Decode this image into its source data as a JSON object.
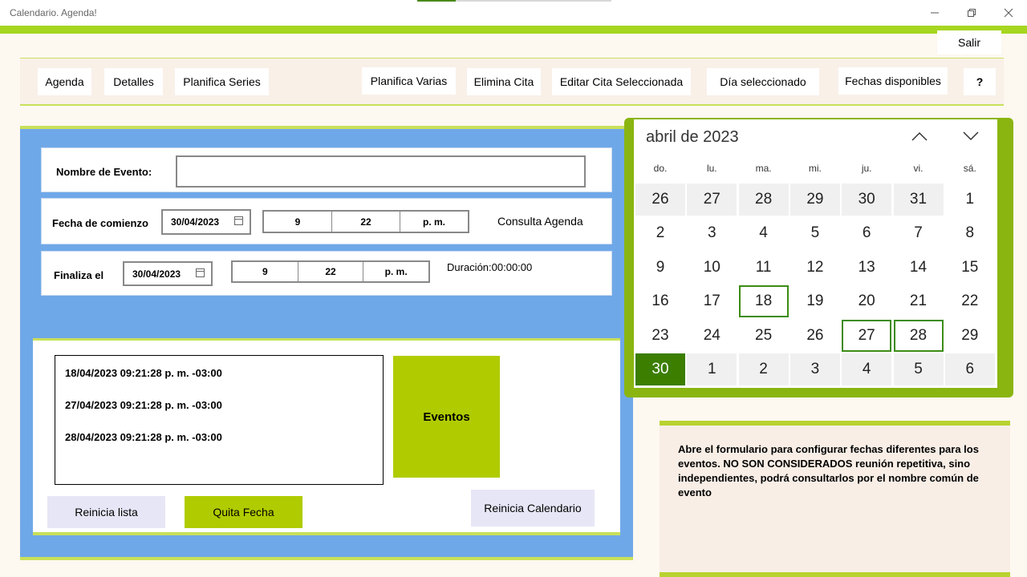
{
  "window": {
    "title": "Calendario. Agenda!",
    "minimize_icon": "minimize-icon",
    "restore_icon": "restore-icon",
    "close_icon": "close-icon"
  },
  "header": {
    "salir_label": "Salir"
  },
  "toolbar": {
    "agenda": "Agenda",
    "detalles": "Detalles",
    "planifica_series": "Planifica Series",
    "planifica_varias": "Planifica Varias",
    "elimina_cita": "Elimina Cita",
    "editar_cita": "Editar Cita Seleccionada",
    "dia_seleccionado": "Día seleccionado",
    "fechas_disponibles": "Fechas disponibles",
    "help": "?"
  },
  "form": {
    "nombre_label": "Nombre de Evento:",
    "nombre_value": "",
    "comienzo_label": "Fecha de comienzo",
    "comienzo_date": "30/04/2023",
    "comienzo_hour": "9",
    "comienzo_minute": "22",
    "comienzo_period": "p. m.",
    "consulta_agenda": "Consulta Agenda",
    "finaliza_label": "Finaliza el",
    "finaliza_date": "30/04/2023",
    "finaliza_hour": "9",
    "finaliza_minute": "22",
    "finaliza_period": "p. m.",
    "duracion": "Duración:00:00:00"
  },
  "events": {
    "items": [
      "18/04/2023 09:21:28 p. m. -03:00",
      "27/04/2023 09:21:28 p. m. -03:00",
      "28/04/2023 09:21:28 p. m. -03:00"
    ],
    "eventos_button": "Eventos",
    "reinicia_lista": "Reinicia lista",
    "quita_fecha": "Quita Fecha",
    "reinicia_calendario": "Reinicia Calendario"
  },
  "calendar": {
    "month_label": "abril de 2023",
    "weekdays": [
      "do.",
      "lu.",
      "ma.",
      "mi.",
      "ju.",
      "vi.",
      "sá."
    ],
    "days": [
      "26",
      "27",
      "28",
      "29",
      "30",
      "31",
      "1",
      "2",
      "3",
      "4",
      "5",
      "6",
      "7",
      "8",
      "9",
      "10",
      "11",
      "12",
      "13",
      "14",
      "15",
      "16",
      "17",
      "18",
      "19",
      "20",
      "21",
      "22",
      "23",
      "24",
      "25",
      "26",
      "27",
      "28",
      "29",
      "30",
      "1",
      "2",
      "3",
      "4",
      "5",
      "6"
    ],
    "other_month_indices": [
      0,
      1,
      2,
      3,
      4,
      5,
      36,
      37,
      38,
      39,
      40,
      41
    ],
    "selected_indices": [
      23,
      32,
      33
    ],
    "today_index": 35,
    "accent_color": "#3b7e00"
  },
  "info": {
    "text": "Abre el formulario para configurar fechas diferentes para los eventos. NO SON CONSIDERADOS reunión repetitiva, sino independientes, podrá consultarlos por el nombre común de evento"
  }
}
